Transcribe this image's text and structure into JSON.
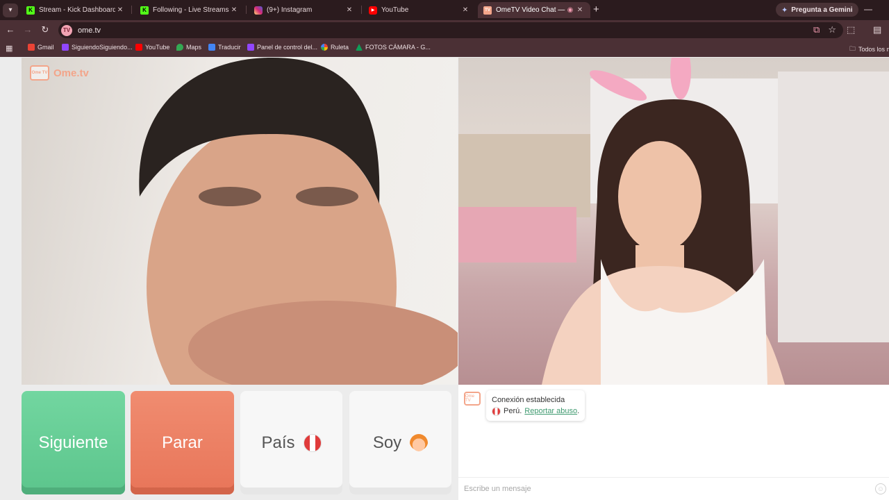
{
  "browser": {
    "tabs": [
      {
        "label": "Stream - Kick Dashboard",
        "favicon": "kick-icon",
        "color": "#53fc18",
        "active": false
      },
      {
        "label": "Following - Live Streams on Kick",
        "favicon": "kick-icon",
        "color": "#53fc18",
        "active": false
      },
      {
        "label": "(9+) Instagram",
        "favicon": "instagram-icon",
        "color": "#d62976",
        "active": false
      },
      {
        "label": "YouTube",
        "favicon": "youtube-icon",
        "color": "#ff0000",
        "active": false
      },
      {
        "label": "OmeTV Video Chat — OmeTV",
        "favicon": "ometv-icon",
        "color": "#f3a58a",
        "active": true
      }
    ],
    "close_glyph": "✕",
    "new_tab_glyph": "+",
    "gemini_label": "Pregunta a Gemini",
    "url": "ome.tv",
    "bookmarks": [
      {
        "label": "Gmail",
        "color": "#ea4335"
      },
      {
        "label": "SiguiendoSiguiendo...",
        "color": "#9146ff"
      },
      {
        "label": "YouTube",
        "color": "#ff0000"
      },
      {
        "label": "Maps",
        "color": "#34a853"
      },
      {
        "label": "Traducir",
        "color": "#4285f4"
      },
      {
        "label": "Panel de control del...",
        "color": "#9146ff"
      },
      {
        "label": "Ruleta",
        "color": "#fbbc05"
      },
      {
        "label": "FOTOS CÁMARA - G...",
        "color": "#0f9d58"
      }
    ],
    "bookmarks_all": "Todos los m"
  },
  "ometv": {
    "logo_text": "Ome.tv",
    "logo_badge": "Ome TV",
    "buttons": {
      "next": "Siguiente",
      "stop": "Parar",
      "country": "País",
      "gender": "Soy"
    },
    "chat": {
      "status": "Conexión establecida",
      "country": "Perú.",
      "report": "Reportar abuso",
      "report_suffix": ".",
      "placeholder": "Escribe un mensaje"
    }
  }
}
